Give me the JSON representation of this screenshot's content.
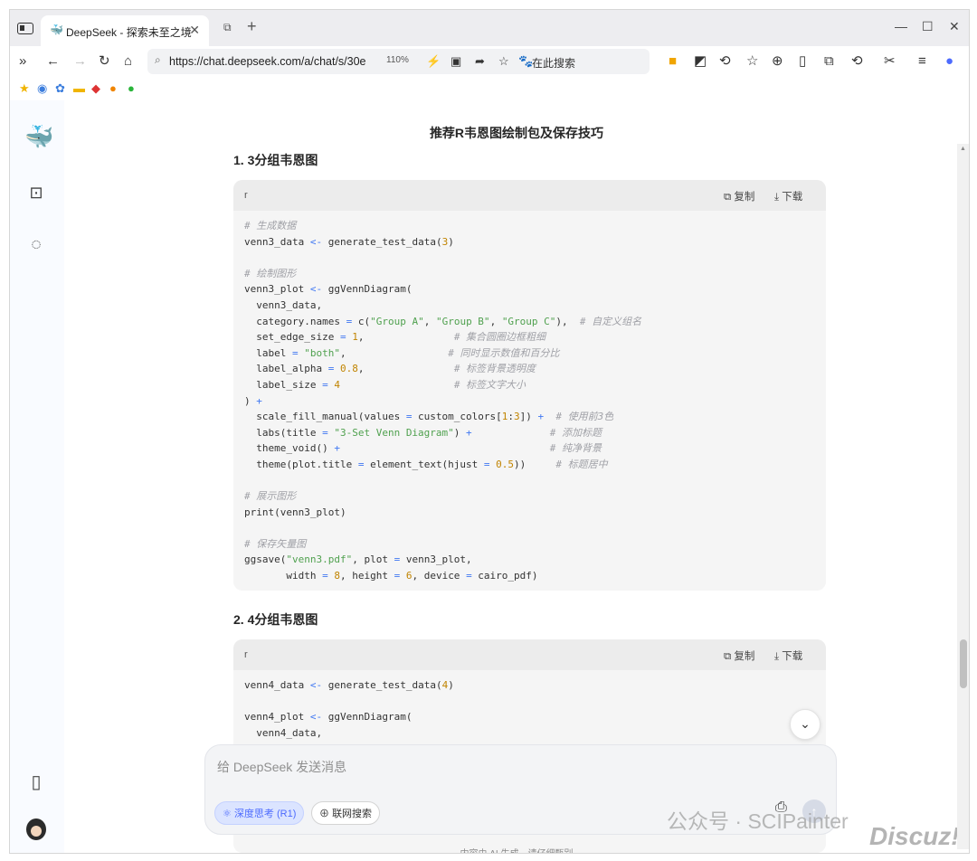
{
  "browser": {
    "tab_title": "DeepSeek - 探索未至之境",
    "url": "https://chat.deepseek.com/a/chat/s/30e",
    "zoom": "110%",
    "search_placeholder": "在此搜索"
  },
  "app": {
    "brand_color": "#4d6bfe",
    "sidebar": {
      "icons": [
        "deepseek-logo-icon",
        "sidebar-toggle-icon",
        "new-chat-icon",
        "phone-icon",
        "avatar"
      ]
    },
    "chat": {
      "title": "推荐R韦恩图绘制包及保存技巧",
      "section1_heading": "1. 3分组韦恩图",
      "section2_heading": "2. 4分组韦恩图"
    },
    "code_blocks": [
      {
        "lang": "r",
        "copy_label": "复制",
        "download_label": "下载"
      },
      {
        "lang": "r",
        "copy_label": "复制",
        "download_label": "下载"
      }
    ],
    "composer": {
      "placeholder": "给 DeepSeek 发送消息",
      "deep_think_label": "深度思考 (R1)",
      "web_search_label": "联网搜索"
    },
    "footer_note": "内容由 AI 生成，请仔细甄别",
    "watermark": "公众号 · SCIPainter",
    "watermark2": "Discuz!"
  }
}
